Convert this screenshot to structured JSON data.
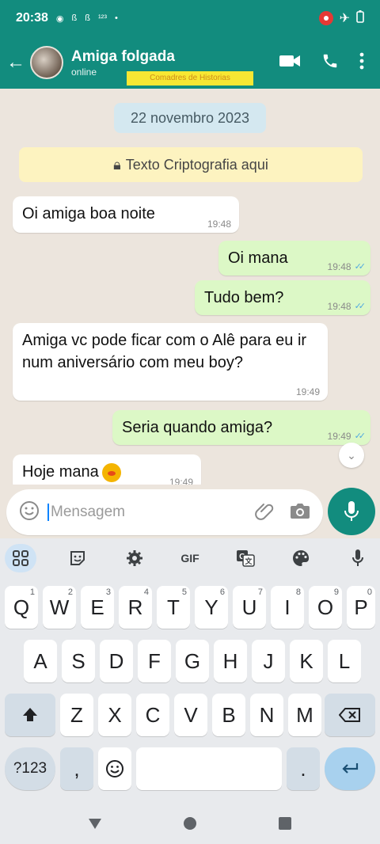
{
  "status_bar": {
    "time": "20:38",
    "left_icons": [
      "whatsapp-status-icon",
      "b-icon",
      "b-icon",
      "123-icon",
      "dot-icon"
    ],
    "right_icons": [
      "record-icon",
      "airplane-icon",
      "battery-icon"
    ]
  },
  "header": {
    "contact_name": "Amiga folgada",
    "status": "online",
    "watermark": "Comadres de Historias"
  },
  "chat": {
    "date": "22 novembro 2023",
    "encryption_notice": "Texto Criptografia aqui",
    "messages": [
      {
        "dir": "in",
        "text": "Oi amiga boa noite",
        "time": "19:48"
      },
      {
        "dir": "out",
        "text": "Oi mana",
        "time": "19:48",
        "read": true
      },
      {
        "dir": "out",
        "text": "Tudo bem?",
        "time": "19:48",
        "read": true
      },
      {
        "dir": "in",
        "text": "Amiga vc pode ficar com o Alê para eu ir num aniversário com meu boy?",
        "time": "19:49"
      },
      {
        "dir": "out",
        "text": "Seria quando amiga?",
        "time": "19:49",
        "read": true
      },
      {
        "dir": "in",
        "text": "Hoje mana",
        "time": "19:49",
        "emoji": "blushing-face-icon"
      }
    ]
  },
  "composer": {
    "placeholder": "Mensagem"
  },
  "keyboard": {
    "toolbar": [
      "apps-icon",
      "sticker-icon",
      "settings-icon",
      "GIF",
      "translate-icon",
      "palette-icon",
      "voice-icon"
    ],
    "row1": [
      {
        "k": "Q",
        "h": "1"
      },
      {
        "k": "W",
        "h": "2"
      },
      {
        "k": "E",
        "h": "3"
      },
      {
        "k": "R",
        "h": "4"
      },
      {
        "k": "T",
        "h": "5"
      },
      {
        "k": "Y",
        "h": "6"
      },
      {
        "k": "U",
        "h": "7"
      },
      {
        "k": "I",
        "h": "8"
      },
      {
        "k": "O",
        "h": "9"
      },
      {
        "k": "P",
        "h": "0"
      }
    ],
    "row2": [
      "A",
      "S",
      "D",
      "F",
      "G",
      "H",
      "J",
      "K",
      "L"
    ],
    "row3": [
      "Z",
      "X",
      "C",
      "V",
      "B",
      "N",
      "M"
    ],
    "row4": {
      "symbols": "?123",
      "comma": ",",
      "period": "."
    },
    "colors": {
      "accent": "#128c7e",
      "bubble_out": "#dcf8c6",
      "bubble_in": "#ffffff"
    }
  }
}
